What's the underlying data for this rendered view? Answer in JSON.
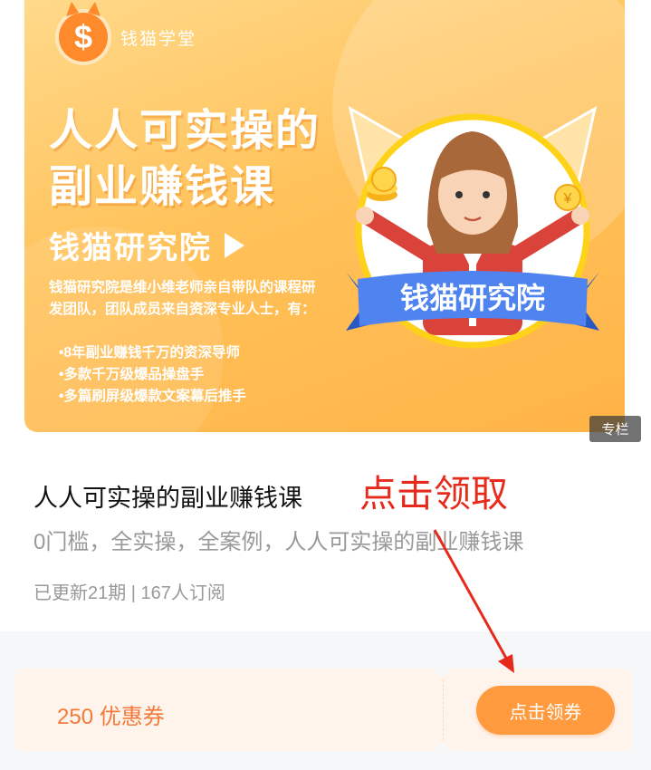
{
  "banner": {
    "logo_text": "钱猫学堂",
    "logo_symbol": "$",
    "headline_line1": "人人可实操的",
    "headline_line2": "副业赚钱课",
    "subheadline": "钱猫研究院",
    "description": "钱猫研究院是维小维老师亲自带队的课程研发团队，团队成员来自资深专业人士，有：",
    "bullets": [
      "•8年副业赚钱千万的资深导师",
      "•多款千万级爆品操盘手",
      "•多篇刷屏级爆款文案幕后推手"
    ],
    "ribbon_text": "钱猫研究院",
    "coin_symbol": "¥",
    "tag": "专栏"
  },
  "course": {
    "title": "人人可实操的副业赚钱课",
    "annotation": "点击领取",
    "subtitle": "0门槛，全实操，全案例，人人可实操的副业赚钱课",
    "stats": "已更新21期 | 167人订阅"
  },
  "coupon": {
    "label": "250 优惠券",
    "button": "点击领券"
  },
  "colors": {
    "accent": "#ff9a3e",
    "annotation_red": "#e62b1d",
    "coupon_bg": "#fff4ec"
  },
  "icons": [
    "cat-coin-logo-icon",
    "play-triangle-icon",
    "coin-icon",
    "yuan-coin-icon",
    "arrow-annotation-icon"
  ]
}
